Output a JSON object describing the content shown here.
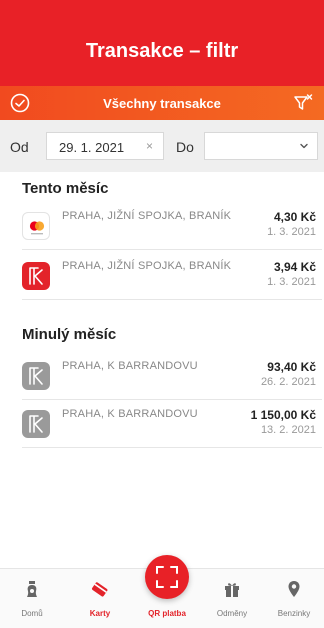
{
  "header": {
    "title": "Transakce – filtr"
  },
  "filter": {
    "label": "Všechny transakce",
    "check_icon": "check-circle-icon",
    "filter_icon": "filter-clear-icon"
  },
  "dates": {
    "from_label": "Od",
    "from_value": "29. 1. 2021",
    "clear_glyph": "×",
    "to_label": "Do",
    "to_value": ""
  },
  "sections": [
    {
      "title": "Tento měsíc",
      "items": [
        {
          "merchant": "PRAHA, JIŽNÍ SPOJKA, BRANÍK",
          "amount": "4,30 Kč",
          "date": "1. 3. 2021",
          "icon": "mastercard-icon"
        },
        {
          "merchant": "PRAHA, JIŽNÍ SPOJKA, BRANÍK",
          "amount": "3,94 Kč",
          "date": "1. 3. 2021",
          "icon": "toll-brand-icon"
        }
      ]
    },
    {
      "title": "Minulý měsíc",
      "items": [
        {
          "merchant": "PRAHA, K BARRANDOVU",
          "amount": "93,40 Kč",
          "date": "26. 2. 2021",
          "icon": "toll-gray-icon"
        },
        {
          "merchant": "PRAHA, K BARRANDOVU",
          "amount": "1 150,00 Kč",
          "date": "13. 2. 2021",
          "icon": "toll-gray-icon"
        }
      ]
    }
  ],
  "nav": {
    "items": [
      {
        "label": "Domů",
        "icon": "home-icon"
      },
      {
        "label": "Karty",
        "icon": "cards-icon"
      },
      {
        "label": "QR platba",
        "icon": "qr-scan-icon"
      },
      {
        "label": "Odměny",
        "icon": "gift-icon"
      },
      {
        "label": "Benzinky",
        "icon": "location-pin-icon"
      }
    ],
    "active": "Karty"
  },
  "colors": {
    "brand_red": "#e82127",
    "orange": "#f46a22"
  }
}
